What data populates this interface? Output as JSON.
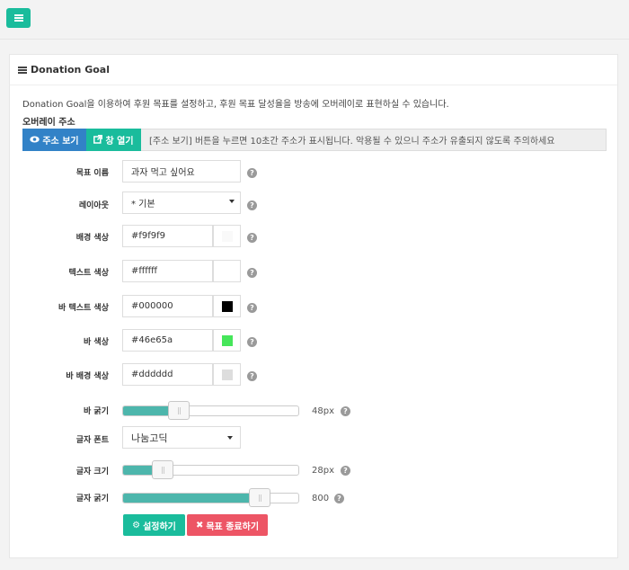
{
  "header": {
    "menu_icon": "hamburger-icon"
  },
  "panel": {
    "title": "Donation Goal",
    "description": "Donation Goal을 이용하여 후원 목표를 설정하고, 후원 목표 달성율을 방송에 오버레이로 표현하실 수 있습니다.",
    "overlay_label": "오버레이 주소",
    "show_address_label": "주소 보기",
    "open_window_label": "창 열기",
    "address_notice": "[주소 보기] 버튼을 누르면 10초간 주소가 표시됩니다. 악용될 수 있으니 주소가 유출되지 않도록 주의하세요"
  },
  "form": {
    "goal_name": {
      "label": "목표 이름",
      "value": "과자 먹고 싶어요"
    },
    "layout": {
      "label": "레이아웃",
      "value": "* 기본"
    },
    "bg_color": {
      "label": "배경 색상",
      "value": "#f9f9f9",
      "swatch": "#f9f9f9"
    },
    "text_color": {
      "label": "텍스트 색상",
      "value": "#ffffff",
      "swatch": "#ffffff"
    },
    "bar_text_color": {
      "label": "바 텍스트 색상",
      "value": "#000000",
      "swatch": "#000000"
    },
    "bar_color": {
      "label": "바 색상",
      "value": "#46e65a",
      "swatch": "#46e65a"
    },
    "bar_bg_color": {
      "label": "바 배경 색상",
      "value": "#dddddd",
      "swatch": "#dddddd"
    },
    "bar_thickness": {
      "label": "바 굵기",
      "value_text": "48px",
      "fraction": 0.29
    },
    "font": {
      "label": "글자 폰트",
      "value": "나눔고딕"
    },
    "font_size": {
      "label": "글자 크기",
      "value_text": "28px",
      "fraction": 0.19
    },
    "font_weight": {
      "label": "글자 굵기",
      "value_text": "800",
      "fraction": 0.82
    },
    "help_glyph": "?"
  },
  "actions": {
    "save_label": "설정하기",
    "end_label": "목표 종료하기"
  },
  "colors": {
    "accent": "#1abc9c",
    "primary": "#3282c7",
    "danger": "#ed5565",
    "slider_fill": "#4db6ac"
  }
}
